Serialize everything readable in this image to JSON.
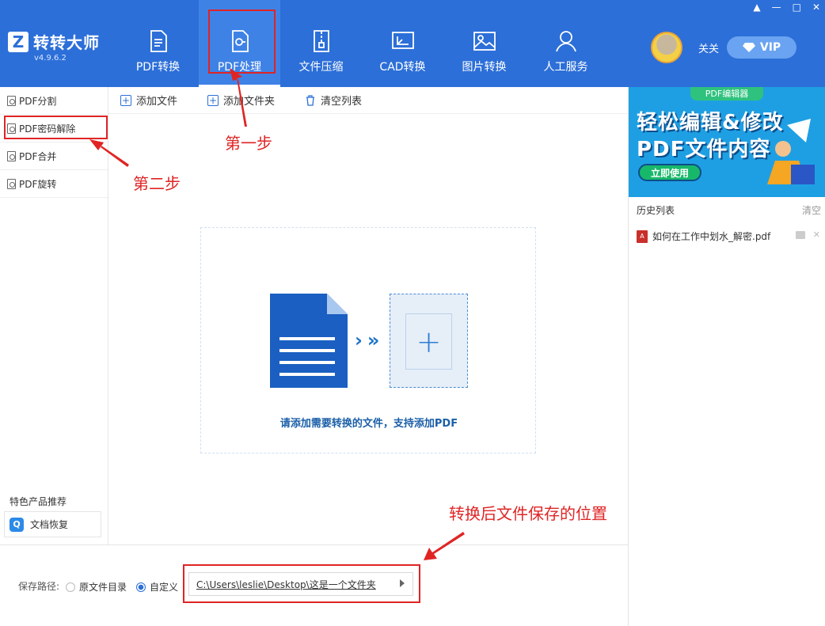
{
  "app": {
    "name": "转转大师",
    "version": "v4.9.6.2",
    "logo_letter": "Z"
  },
  "window_controls": [
    "▲",
    "—",
    "□",
    "✕"
  ],
  "nav": [
    {
      "label": "PDF转换",
      "icon": "pdf-convert-icon",
      "active": false
    },
    {
      "label": "PDF处理",
      "icon": "pdf-process-icon",
      "active": true
    },
    {
      "label": "文件压缩",
      "icon": "zip-icon",
      "active": false
    },
    {
      "label": "CAD转换",
      "icon": "cad-icon",
      "active": false
    },
    {
      "label": "图片转换",
      "icon": "image-icon",
      "active": false
    },
    {
      "label": "人工服务",
      "icon": "person-icon",
      "active": false
    }
  ],
  "user": {
    "name": "关关",
    "vip_label": "VIP"
  },
  "sidebar": {
    "items": [
      {
        "label": "PDF分割"
      },
      {
        "label": "PDF密码解除"
      },
      {
        "label": "PDF合并"
      },
      {
        "label": "PDF旋转"
      }
    ],
    "feature_title": "特色产品推荐",
    "feature_item": "文档恢复"
  },
  "toolbar": {
    "add_file": "添加文件",
    "add_folder": "添加文件夹",
    "clear_list": "清空列表"
  },
  "drop": {
    "hint": "请添加需要转换的文件，支持添加PDF",
    "arrows": "›»",
    "plus": "+"
  },
  "save": {
    "label": "保存路径:",
    "opt_original": "原文件目录",
    "opt_custom": "自定义",
    "path": "C:\\Users\\leslie\\Desktop\\这是一个文件夹"
  },
  "banner": {
    "tag": "PDF编辑器",
    "line1": "轻松编辑&修改",
    "line2": "PDF文件内容",
    "button": "立即使用"
  },
  "history": {
    "title": "历史列表",
    "clear": "清空",
    "items": [
      {
        "name": "如何在工作中划水_解密.pdf"
      }
    ]
  },
  "annotations": {
    "step1": "第一步",
    "step2": "第二步",
    "save_location": "转换后文件保存的位置"
  },
  "colors": {
    "header_blue": "#2c6fd8",
    "annotation_red": "#e02424"
  }
}
